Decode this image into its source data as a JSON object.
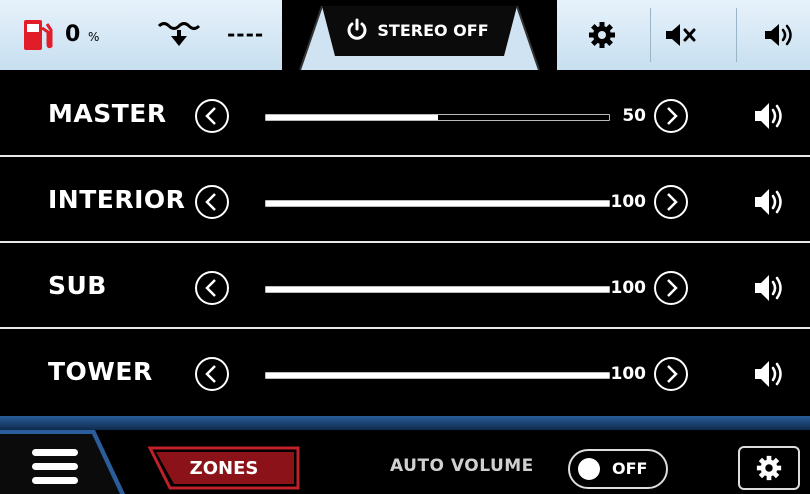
{
  "topbar": {
    "fuel_value": "0",
    "fuel_unit": "%",
    "depth_value": "----",
    "stereo_label": "STEREO OFF",
    "fuel_icon": "fuel-pump-icon",
    "depth_icon": "water-depth-icon",
    "settings_icon": "gear-icon",
    "mute_icon": "speaker-mute-icon",
    "volume_icon": "speaker-icon"
  },
  "zones": [
    {
      "label": "MASTER",
      "value": "50",
      "level": 0.5
    },
    {
      "label": "INTERIOR",
      "value": "100",
      "level": 1.0
    },
    {
      "label": "SUB",
      "value": "100",
      "level": 1.0
    },
    {
      "label": "TOWER",
      "value": "100",
      "level": 1.0
    }
  ],
  "bottombar": {
    "zones_label": "ZONES",
    "auto_volume_label": "AUTO VOLUME",
    "auto_volume_state": "OFF",
    "menu_icon": "hamburger-menu-icon",
    "settings_icon": "gear-icon"
  },
  "colors": {
    "topbar_bg": "#d6e8f5",
    "fuel_red": "#e11d2a",
    "zones_red": "#c0202a",
    "accent_blue": "#2a5d9a"
  }
}
